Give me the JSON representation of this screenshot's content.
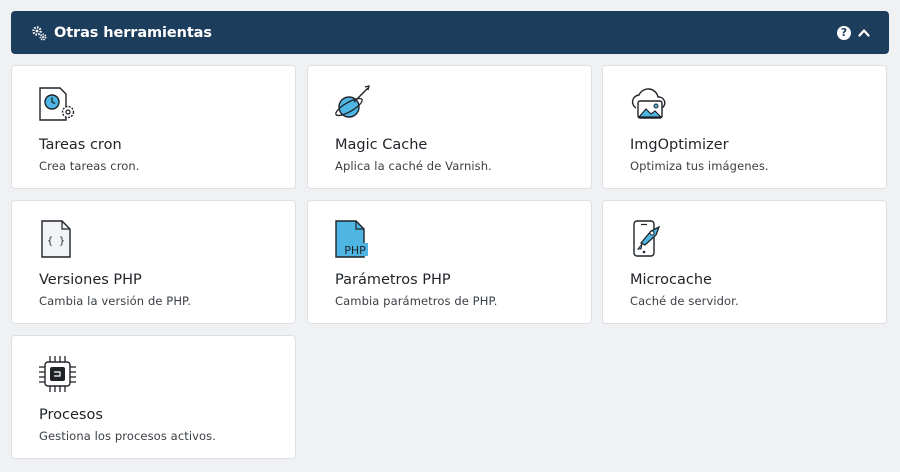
{
  "panel": {
    "title": "Otras herramientas",
    "help_symbol": "?"
  },
  "tools": [
    {
      "name": "Tareas cron",
      "desc": "Crea tareas cron.",
      "icon": "cron-clock-icon"
    },
    {
      "name": "Magic Cache",
      "desc": "Aplica la caché de Varnish.",
      "icon": "magic-cache-icon"
    },
    {
      "name": "ImgOptimizer",
      "desc": "Optimiza tus imágenes.",
      "icon": "image-cloud-icon"
    },
    {
      "name": "Versiones PHP",
      "desc": "Cambia la versión de PHP.",
      "icon": "code-file-icon"
    },
    {
      "name": "Parámetros PHP",
      "desc": "Cambia parámetros de PHP.",
      "icon": "php-file-icon"
    },
    {
      "name": "Microcache",
      "desc": "Caché de servidor.",
      "icon": "phone-rocket-icon"
    },
    {
      "name": "Procesos",
      "desc": "Gestiona los procesos activos.",
      "icon": "cpu-chip-icon"
    }
  ],
  "icon_labels": {
    "php_badge": "PHP",
    "braces": "{ }"
  },
  "colors": {
    "header_bg": "#1d3d5c",
    "icon_accent": "#4fb6e3",
    "icon_stroke": "#1f2328"
  }
}
